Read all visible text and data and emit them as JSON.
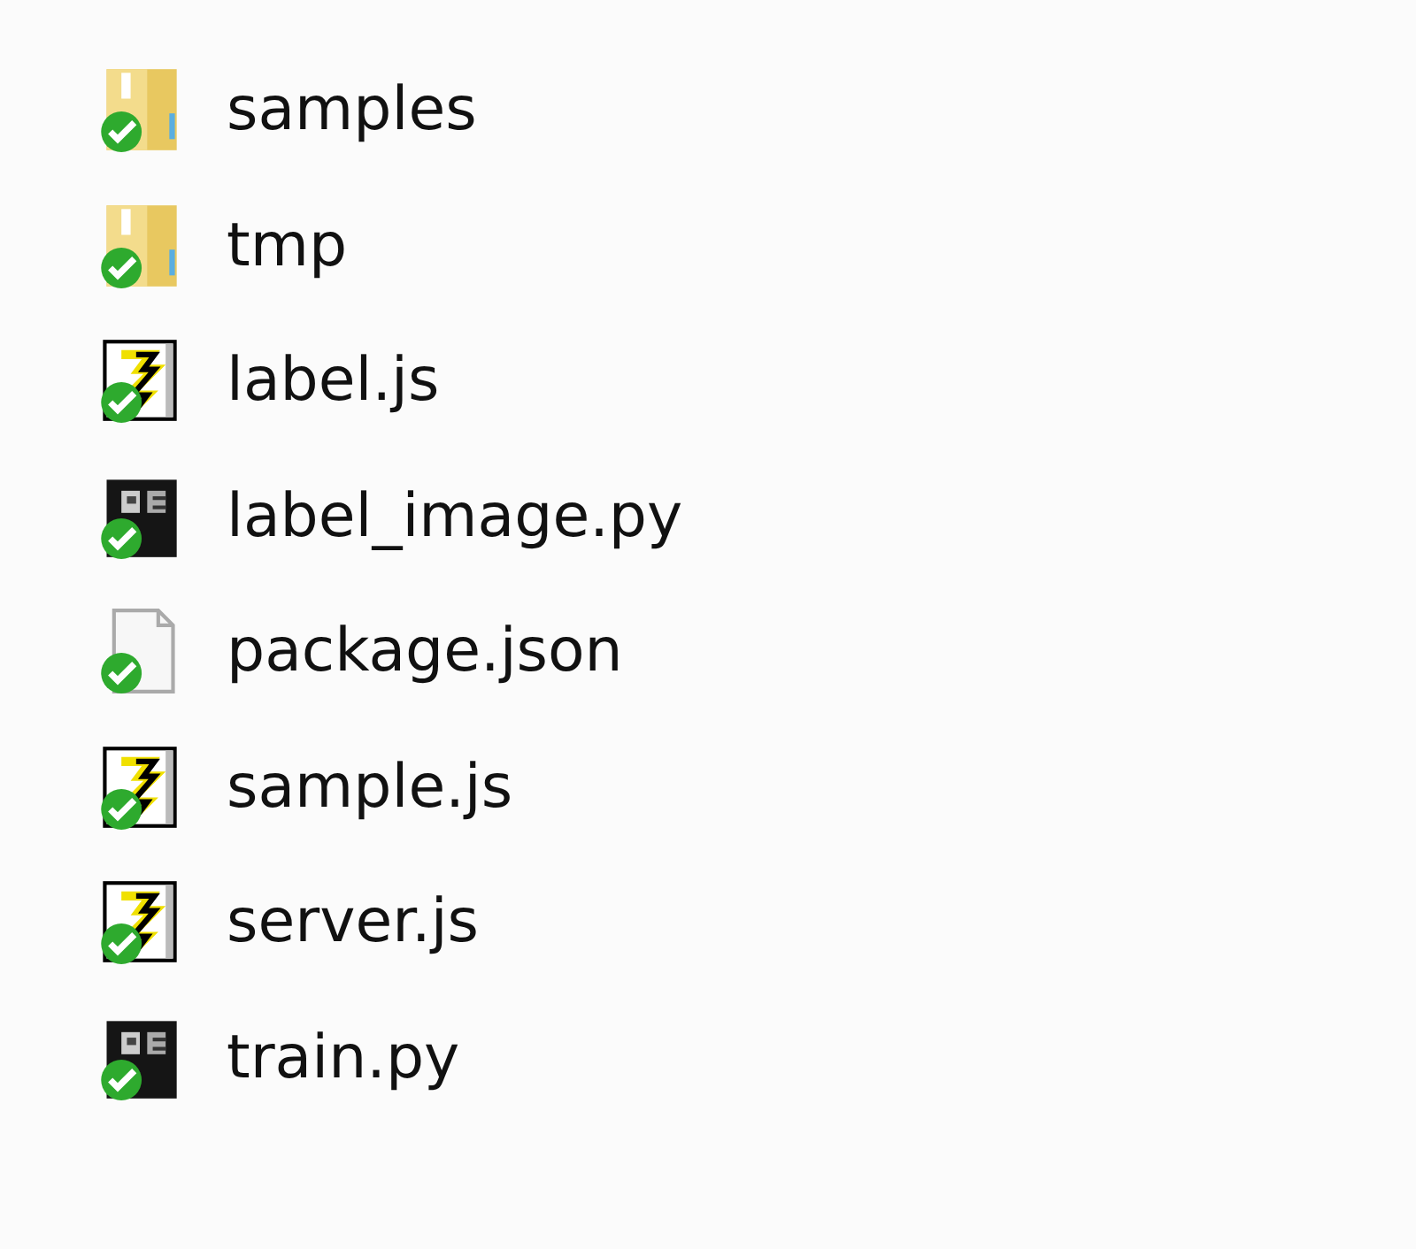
{
  "files": [
    {
      "kind": "folder",
      "name": "samples"
    },
    {
      "kind": "folder",
      "name": "tmp"
    },
    {
      "kind": "script",
      "name": "label.js"
    },
    {
      "kind": "python",
      "name": "label_image.py"
    },
    {
      "kind": "file",
      "name": "package.json"
    },
    {
      "kind": "script",
      "name": "sample.js"
    },
    {
      "kind": "script",
      "name": "server.js"
    },
    {
      "kind": "python",
      "name": "train.py"
    }
  ]
}
